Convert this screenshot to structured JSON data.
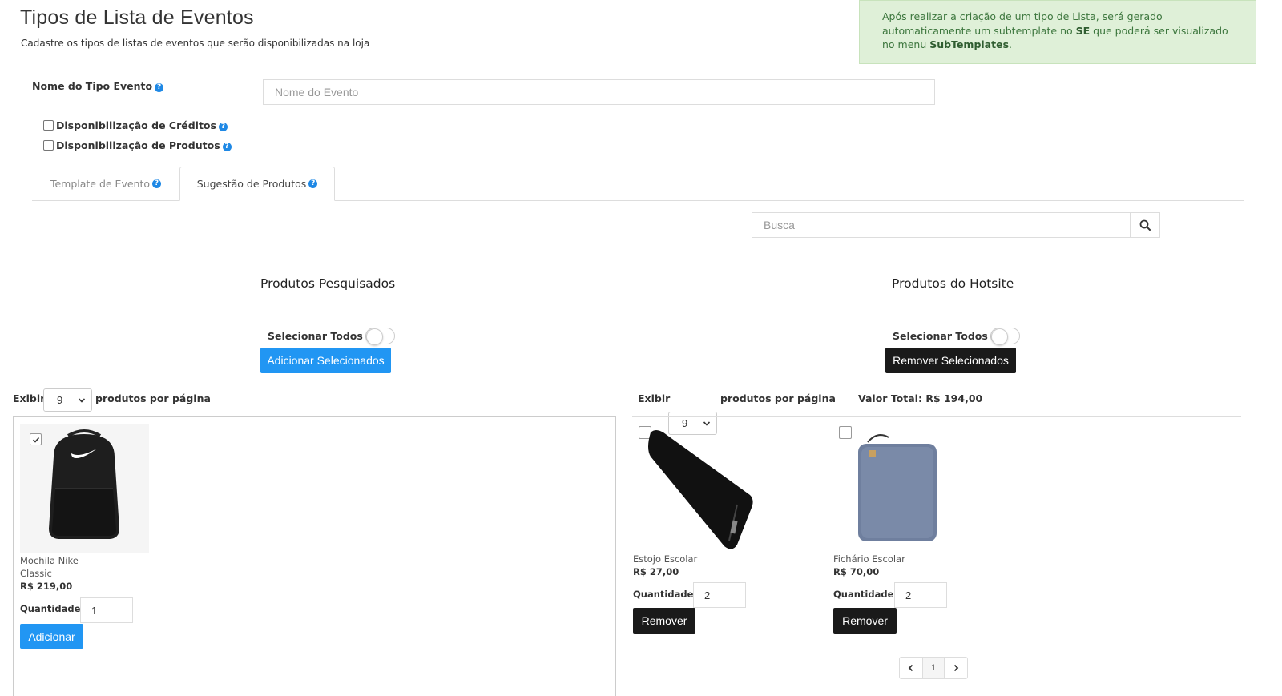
{
  "page": {
    "title": "Tipos de Lista de Eventos",
    "subtitle": "Cadastre os tipos de listas de eventos que serão disponibilizadas na loja"
  },
  "alert": {
    "text_1": "Após realizar a criação de um tipo de Lista, será gerado automaticamente um subtemplate no ",
    "strong_1": "SE",
    "text_2": " que poderá ser visualizado no menu ",
    "strong_2": "SubTemplates",
    "text_3": "."
  },
  "form": {
    "event_name_label": "Nome do Tipo Evento",
    "event_name_placeholder": "Nome do Evento",
    "credits_label": "Disponibilização de Créditos",
    "products_label": "Disponibilização de Produtos",
    "help_glyph": "?"
  },
  "tabs": [
    {
      "label": "Template de Evento",
      "active": false
    },
    {
      "label": "Sugestão de Produtos",
      "active": true
    }
  ],
  "search": {
    "placeholder": "Busca"
  },
  "searched": {
    "title": "Produtos Pesquisados",
    "select_all_label": "Selecionar Todos",
    "add_selected_label": "Adicionar Selecionados",
    "show_label": "Exibir",
    "per_page_value": "9",
    "per_page_suffix": "produtos por página",
    "products": [
      {
        "name_line1": "Mochila Nike",
        "name_line2": "Classic",
        "price": "R$ 219,00",
        "qty_label": "Quantidade:",
        "qty": "1",
        "checked": true,
        "action_label": "Adicionar"
      }
    ]
  },
  "hotsite": {
    "title": "Produtos do Hotsite",
    "select_all_label": "Selecionar Todos",
    "remove_selected_label": "Remover Selecionados",
    "show_label": "Exibir",
    "per_page_value": "9",
    "per_page_suffix": "produtos por página",
    "total_label": "Valor Total: R$ 194,00",
    "products": [
      {
        "name": "Estojo Escolar",
        "price": "R$ 27,00",
        "qty_label": "Quantidade:",
        "qty": "2",
        "checked": false,
        "action_label": "Remover"
      },
      {
        "name": "Fichário Escolar",
        "price": "R$ 70,00",
        "qty_label": "Quantidade:",
        "qty": "2",
        "checked": false,
        "action_label": "Remover"
      }
    ],
    "pagination": {
      "current": "1"
    }
  },
  "colors": {
    "primary_blue": "#2196f3",
    "dark_button": "#1a1a1a",
    "alert_bg": "#dff0d8",
    "help_icon": "#1e88e5"
  }
}
